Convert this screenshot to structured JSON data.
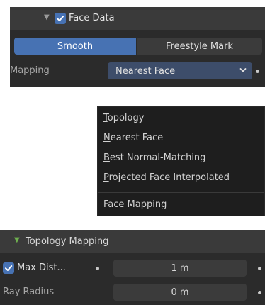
{
  "face_data": {
    "title": "Face Data",
    "enabled": true,
    "tabs": [
      "Smooth",
      "Freestyle Mark"
    ],
    "active_tab": "Smooth",
    "mapping_label": "Mapping",
    "mapping_value": "Nearest Face"
  },
  "mapping_menu": {
    "items": [
      {
        "accel": "T",
        "rest": "opology"
      },
      {
        "accel": "N",
        "rest": "earest Face"
      },
      {
        "accel": "B",
        "rest": "est Normal-Matching"
      },
      {
        "accel": "P",
        "rest": "rojected Face Interpolated"
      }
    ],
    "footer": "Face Mapping"
  },
  "topology_mapping": {
    "title": "Topology Mapping",
    "max_dist_label": "Max Dist...",
    "max_dist_enabled": true,
    "max_dist_value": "1 m",
    "ray_radius_label": "Ray Radius",
    "ray_radius_value": "0 m"
  },
  "colors": {
    "accent": "#4772b3",
    "panel": "#2b2b2b",
    "header": "#3a3a3a",
    "menu_bg": "#1e1e1e",
    "green_arrow": "#6fb04f"
  },
  "icons": [
    "disclosure-arrow-icon",
    "checkbox-icon",
    "chevron-down-icon",
    "decorator-dot-icon"
  ]
}
